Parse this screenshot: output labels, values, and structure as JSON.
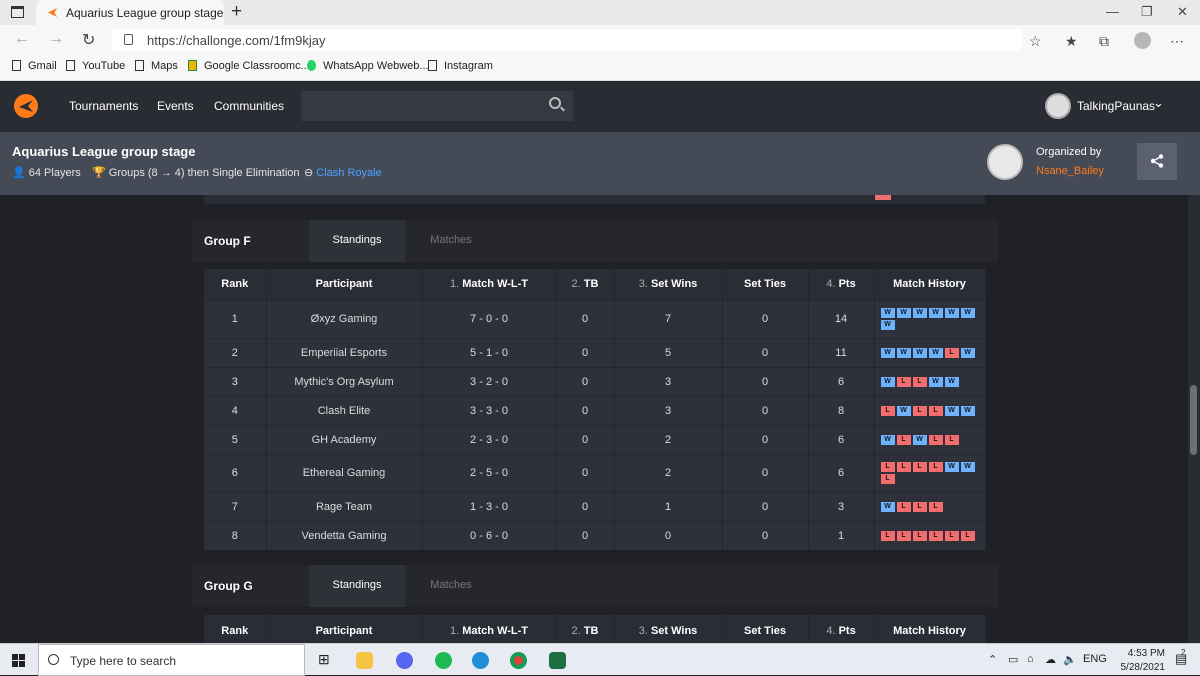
{
  "browser": {
    "tab_title": "Aquarius League group stage - C",
    "close_glyph": "✕",
    "new_tab_glyph": "+",
    "url": "https://challonge.com/1fm9kjay",
    "bookmarks": [
      "Gmail",
      "YouTube",
      "Maps",
      "Google Classroomc...",
      "WhatsApp Webweb...",
      "Instagram"
    ]
  },
  "site_nav": {
    "links": [
      "Tournaments",
      "Events",
      "Communities"
    ],
    "search_placeholder": "",
    "user_name": "TalkingPaunas"
  },
  "tournament": {
    "title": "Aquarius League group stage",
    "players": "64 Players",
    "format": "Groups (8 → 4) then Single Elimination",
    "game": "Clash Royale",
    "organized_by_label": "Organized by",
    "organizer": "Nsane_Bailey"
  },
  "columns": [
    {
      "num": "",
      "label": "Rank"
    },
    {
      "num": "",
      "label": "Participant"
    },
    {
      "num": "1.",
      "label": "Match W-L-T"
    },
    {
      "num": "2.",
      "label": "TB"
    },
    {
      "num": "3.",
      "label": "Set Wins"
    },
    {
      "num": "",
      "label": "Set Ties"
    },
    {
      "num": "4.",
      "label": "Pts"
    },
    {
      "num": "",
      "label": "Match History"
    }
  ],
  "groups": [
    {
      "name": "Group F",
      "tab_standings": "Standings",
      "tab_matches": "Matches",
      "rows": [
        {
          "rank": "1",
          "participant": "Øxyz Gaming",
          "wlt": "7 - 0 - 0",
          "tb": "0",
          "set_wins": "7",
          "set_ties": "0",
          "pts": "14",
          "history": "WWWWWWW"
        },
        {
          "rank": "2",
          "participant": "Emperiial Esports",
          "wlt": "5 - 1 - 0",
          "tb": "0",
          "set_wins": "5",
          "set_ties": "0",
          "pts": "11",
          "history": "WWWWLW"
        },
        {
          "rank": "3",
          "participant": "Mythic's Org Asylum",
          "wlt": "3 - 2 - 0",
          "tb": "0",
          "set_wins": "3",
          "set_ties": "0",
          "pts": "6",
          "history": "WLLWW"
        },
        {
          "rank": "4",
          "participant": "Clash Elite",
          "wlt": "3 - 3 - 0",
          "tb": "0",
          "set_wins": "3",
          "set_ties": "0",
          "pts": "8",
          "history": "LWLLWW"
        },
        {
          "rank": "5",
          "participant": "GH Academy",
          "wlt": "2 - 3 - 0",
          "tb": "0",
          "set_wins": "2",
          "set_ties": "0",
          "pts": "6",
          "history": "WLWLL"
        },
        {
          "rank": "6",
          "participant": "Ethereal Gaming",
          "wlt": "2 - 5 - 0",
          "tb": "0",
          "set_wins": "2",
          "set_ties": "0",
          "pts": "6",
          "history": "LLLLWWL"
        },
        {
          "rank": "7",
          "participant": "Rage Team",
          "wlt": "1 - 3 - 0",
          "tb": "0",
          "set_wins": "1",
          "set_ties": "0",
          "pts": "3",
          "history": "WLLL"
        },
        {
          "rank": "8",
          "participant": "Vendetta Gaming",
          "wlt": "0 - 6 - 0",
          "tb": "0",
          "set_wins": "0",
          "set_ties": "0",
          "pts": "1",
          "history": "LLLLLL"
        }
      ]
    },
    {
      "name": "Group G",
      "tab_standings": "Standings",
      "tab_matches": "Matches",
      "rows": []
    }
  ],
  "taskbar": {
    "search_placeholder": "Type here to search",
    "language": "ENG",
    "time": "4:53 PM",
    "date": "5/28/2021",
    "notification_count": "2"
  },
  "colors": {
    "brand_orange": "#ff7a18",
    "win": "#6db2ff",
    "loss": "#f26d6d",
    "link_blue": "#4aa3ff"
  }
}
